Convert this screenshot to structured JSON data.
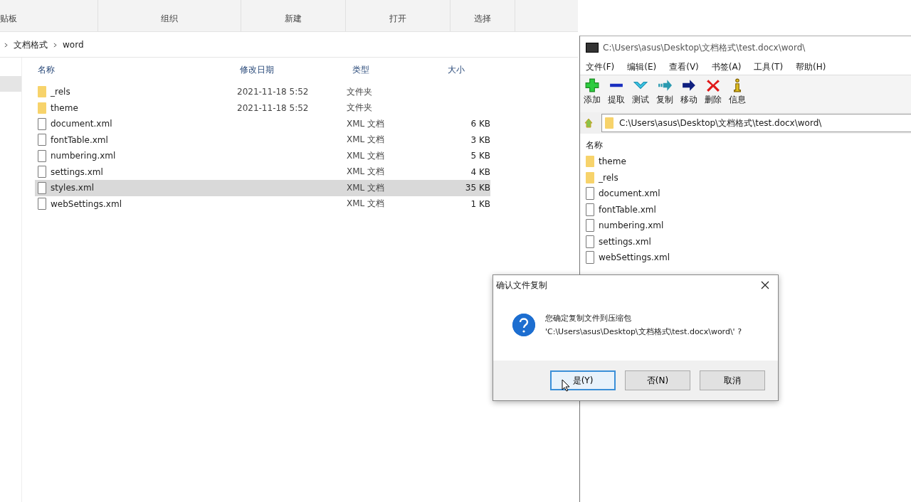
{
  "explorer": {
    "ribbon_groups": [
      "贴板",
      "组织",
      "新建",
      "打开",
      "选择"
    ],
    "breadcrumb": [
      "文档格式",
      "word"
    ],
    "columns": [
      "名称",
      "修改日期",
      "类型",
      "大小"
    ],
    "files": [
      {
        "kind": "folder",
        "name": "_rels",
        "date": "2021-11-18 5:52",
        "type": "文件夹",
        "selected": false
      },
      {
        "kind": "folder",
        "name": "theme",
        "date": "2021-11-18 5:52",
        "type": "文件夹",
        "selected": false
      },
      {
        "kind": "file",
        "name": "document.xml",
        "type": "XML 文档",
        "size": "6 KB",
        "selected": false
      },
      {
        "kind": "file",
        "name": "fontTable.xml",
        "type": "XML 文档",
        "size": "3 KB",
        "selected": false
      },
      {
        "kind": "file",
        "name": "numbering.xml",
        "type": "XML 文档",
        "size": "5 KB",
        "selected": false
      },
      {
        "kind": "file",
        "name": "settings.xml",
        "type": "XML 文档",
        "size": "4 KB",
        "selected": false
      },
      {
        "kind": "file",
        "name": "styles.xml",
        "type": "XML 文档",
        "size": "35 KB",
        "selected": true
      },
      {
        "kind": "file",
        "name": "webSettings.xml",
        "type": "XML 文档",
        "size": "1 KB",
        "selected": false
      }
    ]
  },
  "archiver": {
    "title": "C:\\Users\\asus\\Desktop\\文档格式\\test.docx\\word\\",
    "menu": [
      "文件(F)",
      "编辑(E)",
      "查看(V)",
      "书签(A)",
      "工具(T)",
      "帮助(H)"
    ],
    "toolbar": [
      {
        "kind": "add",
        "label": "添加"
      },
      {
        "kind": "extract",
        "label": "提取"
      },
      {
        "kind": "test",
        "label": "测试"
      },
      {
        "kind": "copy",
        "label": "复制"
      },
      {
        "kind": "move",
        "label": "移动"
      },
      {
        "kind": "delete",
        "label": "删除"
      },
      {
        "kind": "info",
        "label": "信息"
      }
    ],
    "address": "C:\\Users\\asus\\Desktop\\文档格式\\test.docx\\word\\",
    "column": "名称",
    "items": [
      {
        "kind": "folder",
        "name": "theme"
      },
      {
        "kind": "folder",
        "name": "_rels"
      },
      {
        "kind": "file",
        "name": "document.xml"
      },
      {
        "kind": "file",
        "name": "fontTable.xml"
      },
      {
        "kind": "file",
        "name": "numbering.xml"
      },
      {
        "kind": "file",
        "name": "settings.xml"
      },
      {
        "kind": "file",
        "name": "webSettings.xml"
      }
    ]
  },
  "dialog": {
    "title": "确认文件复制",
    "message": "您确定复制文件到压缩包",
    "path": "'C:\\Users\\asus\\Desktop\\文档格式\\test.docx\\word\\' ?",
    "buttons": [
      {
        "label": "是(Y)",
        "selected": true
      },
      {
        "label": "否(N)",
        "selected": false
      },
      {
        "label": "取消",
        "selected": false
      }
    ]
  }
}
